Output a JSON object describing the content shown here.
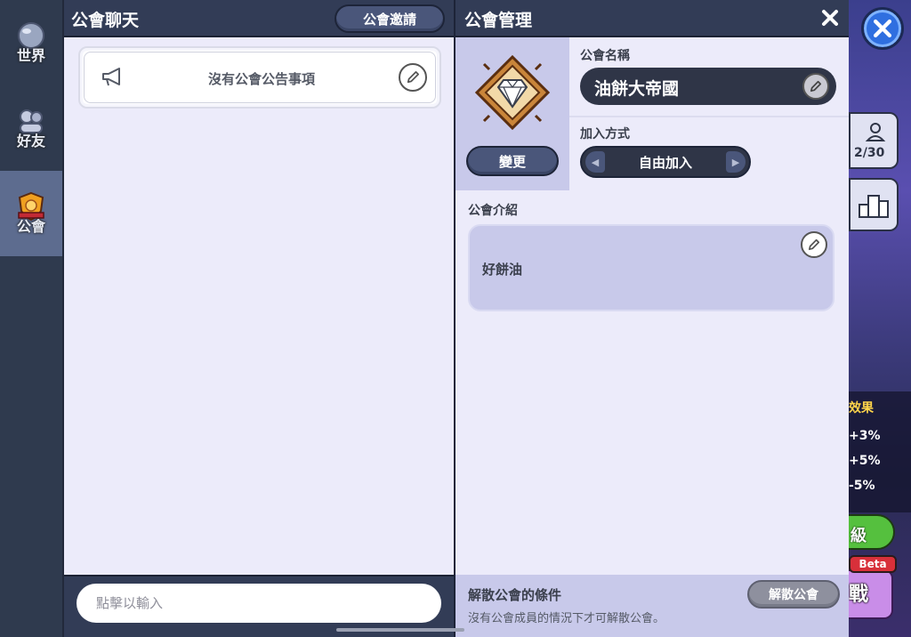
{
  "colors": {
    "header_bg": "#323c56",
    "panel_bg": "#ecebfa",
    "panel_alt_bg": "#c8c9ea",
    "sidebar_bg": "#2f3a4e",
    "sidebar_active_bg": "#5d6c8f"
  },
  "sidebar": {
    "items": [
      {
        "label": "世界",
        "icon": "globe-icon"
      },
      {
        "label": "好友",
        "icon": "friends-icon"
      },
      {
        "label": "公會",
        "icon": "guild-shield-icon"
      }
    ]
  },
  "chat": {
    "title": "公會聊天",
    "invite_label": "公會邀請",
    "notice_text": "沒有公會公告事項",
    "input_placeholder": "點擊以輸入"
  },
  "manage": {
    "title": "公會管理",
    "change_label": "變更",
    "name_label": "公會名稱",
    "name_value": "油餅大帝國",
    "join_label": "加入方式",
    "join_value": "自由加入",
    "intro_label": "公會介紹",
    "intro_text": "好餅油",
    "disband_title": "解散公會的條件",
    "disband_desc": "沒有公會成員的情況下才可解散公會。",
    "disband_label": "解散公會"
  },
  "game_edge": {
    "members_count": "2/30",
    "effect_title": "效果",
    "effects": [
      "+3%",
      "+5%",
      "-5%"
    ],
    "level_label": "級",
    "beta_label": "Beta",
    "battle_label": "戰"
  }
}
